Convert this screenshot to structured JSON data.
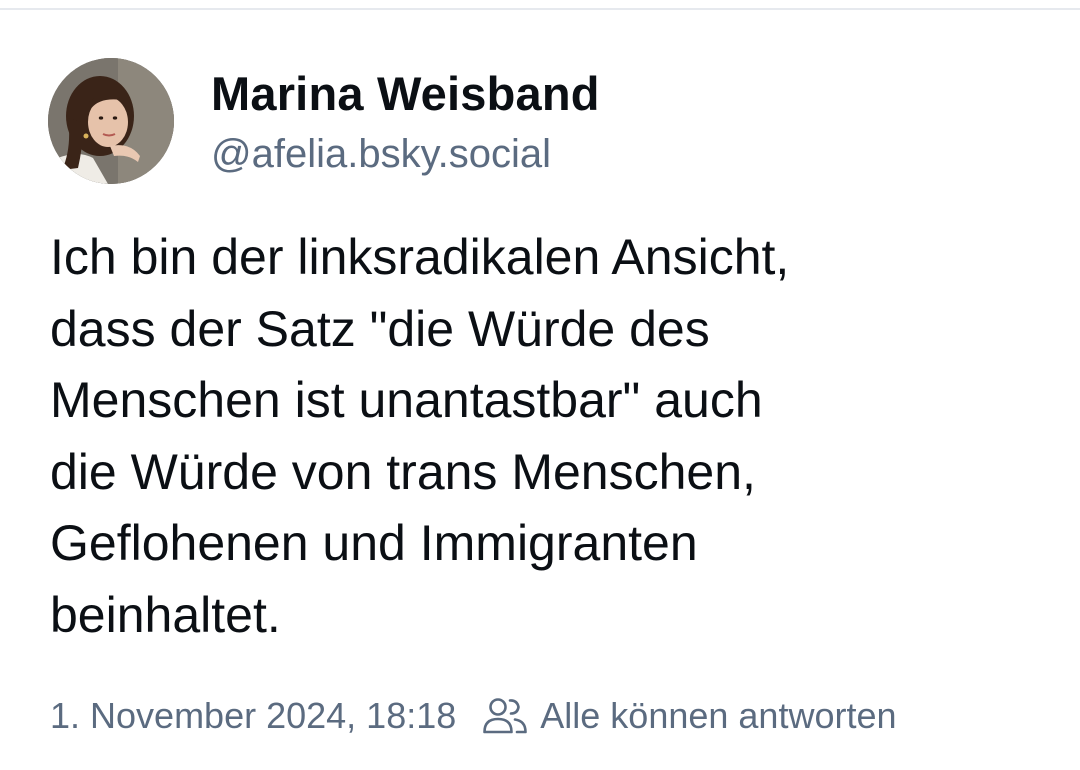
{
  "post": {
    "author": {
      "display_name": "Marina Weisband",
      "handle": "@afelia.bsky.social",
      "avatar_icon": "person-photo"
    },
    "text": "Ich bin der linksradikalen Ansicht,\ndass der Satz \"die Würde des\nMenschen ist unantastbar\" auch\ndie Würde von trans Menschen,\nGeflohenen und Immigranten\nbeinhaltet.",
    "timestamp": "1. November 2024, 18:18",
    "reply_setting": {
      "icon": "people-icon",
      "label": "Alle können antworten"
    }
  },
  "colors": {
    "text_primary": "#0b0f14",
    "text_secondary": "#5b6b80",
    "divider": "#e6e9ee",
    "background": "#ffffff"
  }
}
